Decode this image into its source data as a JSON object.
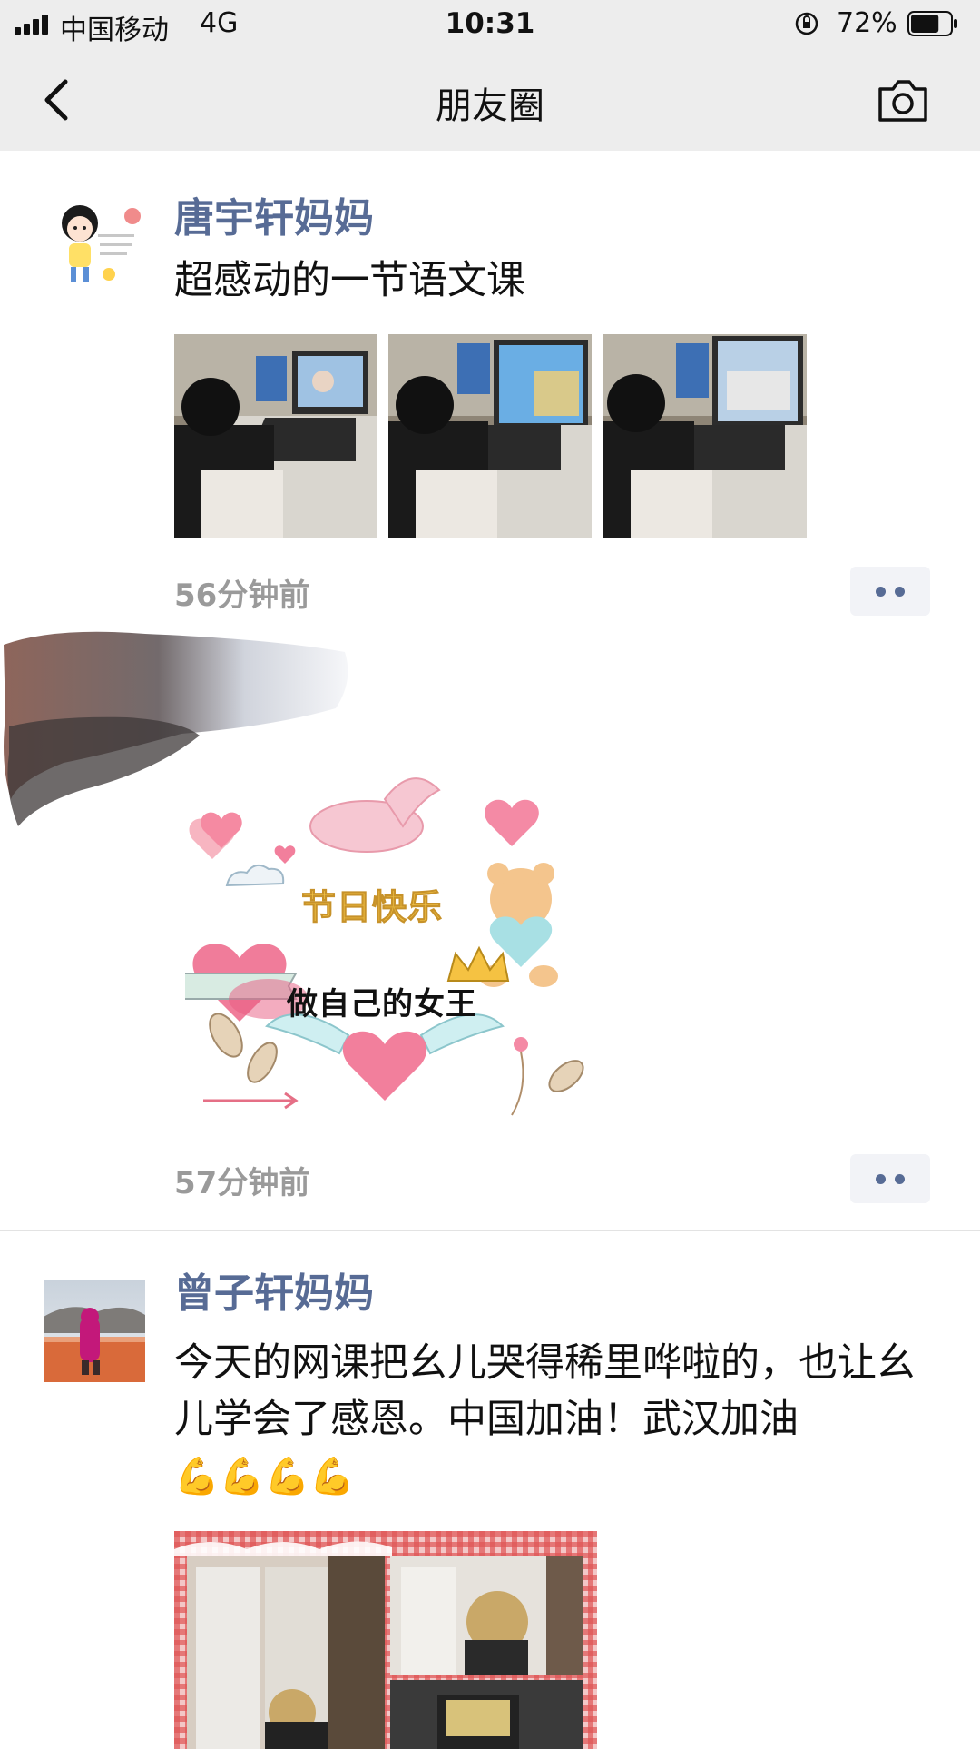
{
  "status_bar": {
    "carrier": "中国移动",
    "network": "4G",
    "time": "10:31",
    "battery_percent": "72%",
    "battery_level": 0.72
  },
  "nav": {
    "title": "朋友圈",
    "back_icon": "chevron-left-icon",
    "camera_icon": "camera-icon"
  },
  "posts": [
    {
      "author": "唐宇轩妈妈",
      "text": "超感动的一节语文课",
      "time": "56分钟前",
      "image_count": 3
    },
    {
      "author": "",
      "image_text_1": "节日快乐",
      "image_text_2": "做自己的女王",
      "time": "57分钟前"
    },
    {
      "author": "曾子轩妈妈",
      "text": "今天的网课把幺儿哭得稀里哗啦的，也让幺儿学会了感恩。中国加油！武汉加油",
      "emoji": "💪💪💪💪"
    }
  ],
  "colors": {
    "nav_background": "#ededed",
    "username": "#576b95",
    "timestamp": "#9a9a9a"
  }
}
